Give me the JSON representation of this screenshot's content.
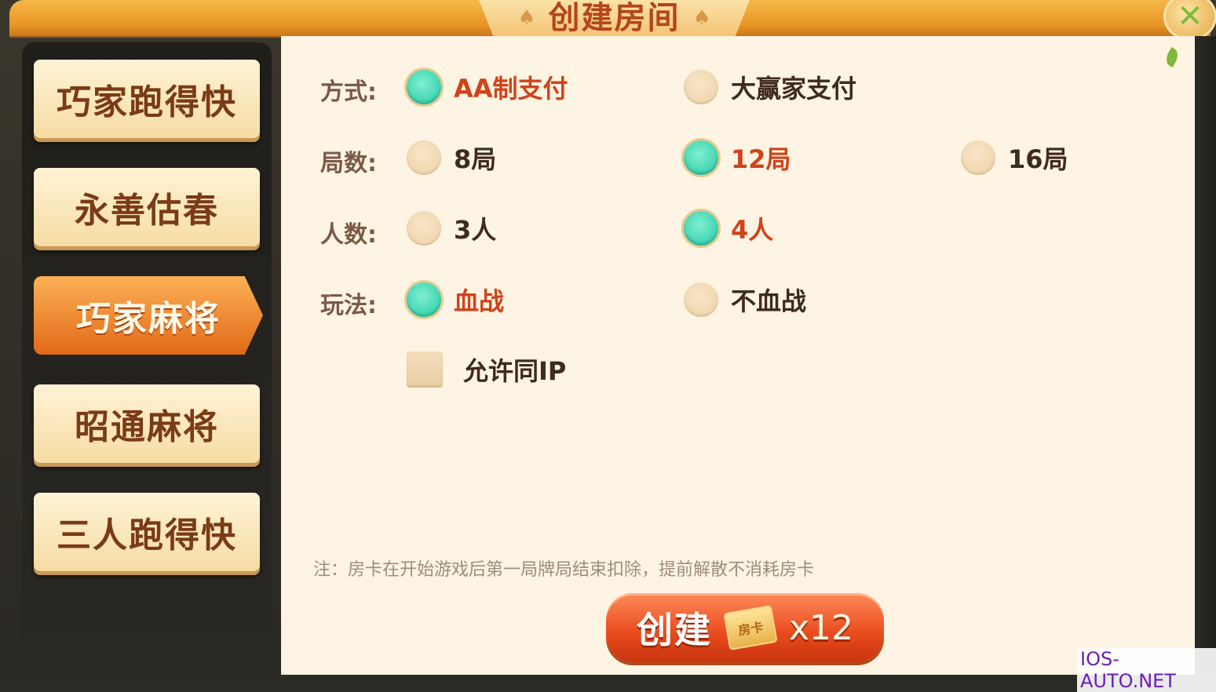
{
  "dialog": {
    "title": "创建房间",
    "close_icon": "close-icon"
  },
  "sidebar": {
    "tabs": [
      {
        "label": "巧家跑得快",
        "active": false
      },
      {
        "label": "永善估春",
        "active": false
      },
      {
        "label": "巧家麻将",
        "active": true
      },
      {
        "label": "昭通麻将",
        "active": false
      },
      {
        "label": "三人跑得快",
        "active": false
      }
    ]
  },
  "options": {
    "payment": {
      "label": "方式:",
      "choices": [
        {
          "text": "AA制支付",
          "selected": true
        },
        {
          "text": "大赢家支付",
          "selected": false
        }
      ]
    },
    "rounds": {
      "label": "局数:",
      "choices": [
        {
          "text": "8局",
          "selected": false
        },
        {
          "text": "12局",
          "selected": true
        },
        {
          "text": "16局",
          "selected": false
        }
      ]
    },
    "players": {
      "label": "人数:",
      "choices": [
        {
          "text": "3人",
          "selected": false
        },
        {
          "text": "4人",
          "selected": true
        }
      ]
    },
    "mode": {
      "label": "玩法:",
      "choices": [
        {
          "text": "血战",
          "selected": true
        },
        {
          "text": "不血战",
          "selected": false
        }
      ]
    },
    "same_ip": {
      "text": "允许同IP",
      "checked": false
    }
  },
  "note": "注：房卡在开始游戏后第一局牌局结束扣除，提前解散不消耗房卡",
  "create_button": {
    "label": "创建",
    "card_label": "房卡",
    "cost": "x12"
  },
  "watermark": "IOS-AUTO.NET",
  "colors": {
    "accent_orange": "#e16a17",
    "selected_text": "#d0431b",
    "radio_on": "#23c7a4",
    "panel_bg": "#fdf4e3"
  }
}
